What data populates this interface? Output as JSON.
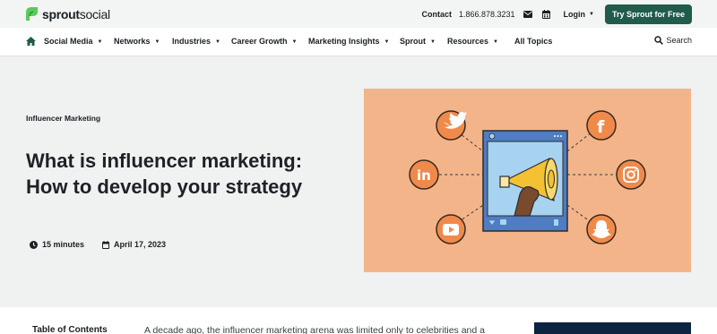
{
  "topbar": {
    "logo_bold": "sprout",
    "logo_light": "social",
    "contact_label": "Contact",
    "phone": "1.866.878.3231",
    "login_label": "Login",
    "cta_label": "Try Sprout for Free"
  },
  "nav": {
    "items": [
      {
        "label": "Social Media"
      },
      {
        "label": "Networks"
      },
      {
        "label": "Industries"
      },
      {
        "label": "Career Growth"
      },
      {
        "label": "Marketing Insights"
      },
      {
        "label": "Sprout"
      },
      {
        "label": "Resources"
      },
      {
        "label": "All Topics"
      }
    ],
    "search_label": "Search"
  },
  "hero": {
    "category": "Influencer Marketing",
    "title": "What is influencer marketing: How to develop your strategy",
    "read_time": "15 minutes",
    "date": "April 17, 2023"
  },
  "article": {
    "toc_label": "Table of Contents",
    "intro": "A decade ago, the influencer marketing arena was limited only to celebrities and a"
  },
  "colors": {
    "brand_green": "#205b4c",
    "illustration_bg": "#f3b48a",
    "icon_orange": "#f08a4b"
  }
}
